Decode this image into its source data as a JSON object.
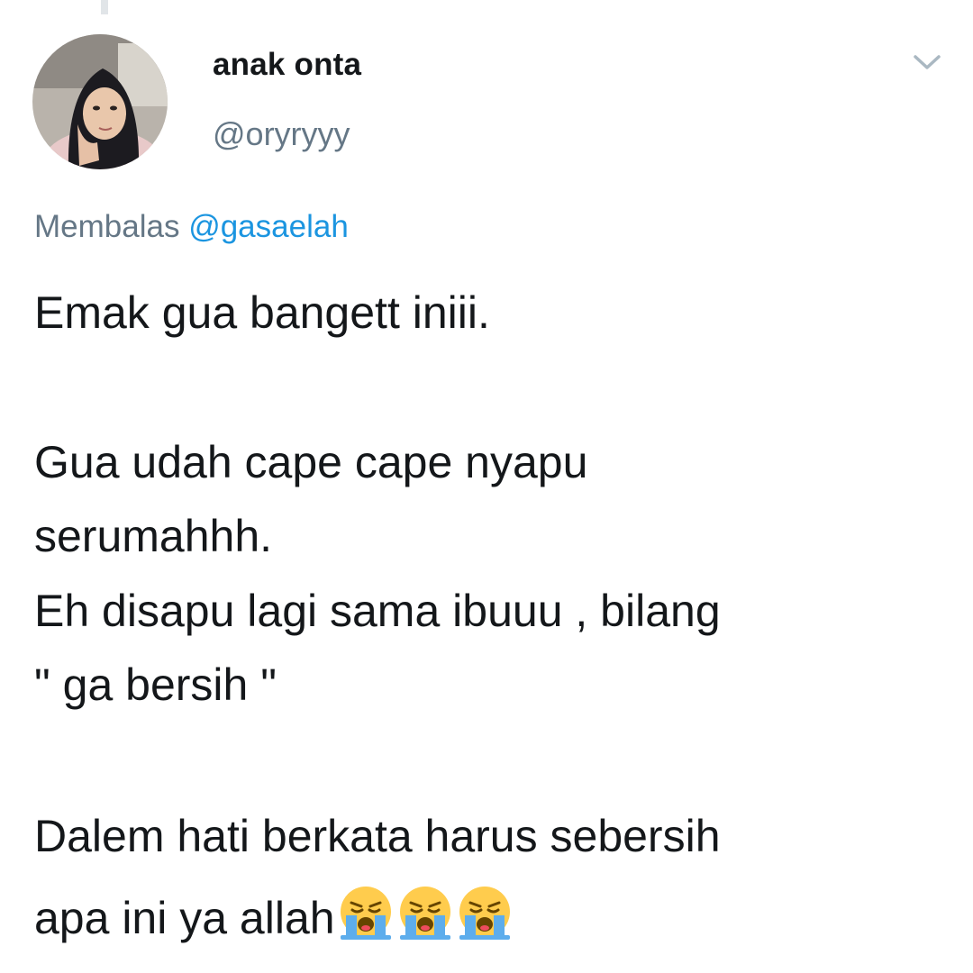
{
  "tweet": {
    "author": {
      "display_name": "anak onta",
      "handle": "@oryryyy"
    },
    "reply": {
      "prefix": "Membalas",
      "mention": "@gasaelah"
    },
    "lines": [
      "Emak gua bangett iniii.",
      "Gua udah cape cape nyapu",
      "serumahhh.",
      "Eh disapu lagi sama ibuuu , bilang",
      "\" ga bersih \"",
      "Dalem hati berkata harus sebersih",
      "apa ini ya allah"
    ],
    "trailing_emoji": [
      "loudly-crying-face-emoji",
      "loudly-crying-face-emoji",
      "loudly-crying-face-emoji"
    ]
  },
  "icons": {
    "menu": "chevron-down-icon"
  },
  "colors": {
    "text_primary": "#14171a",
    "text_secondary": "#657786",
    "link": "#1b95e0",
    "emoji_face": "#ffcc4d",
    "emoji_tears": "#5dadec"
  }
}
